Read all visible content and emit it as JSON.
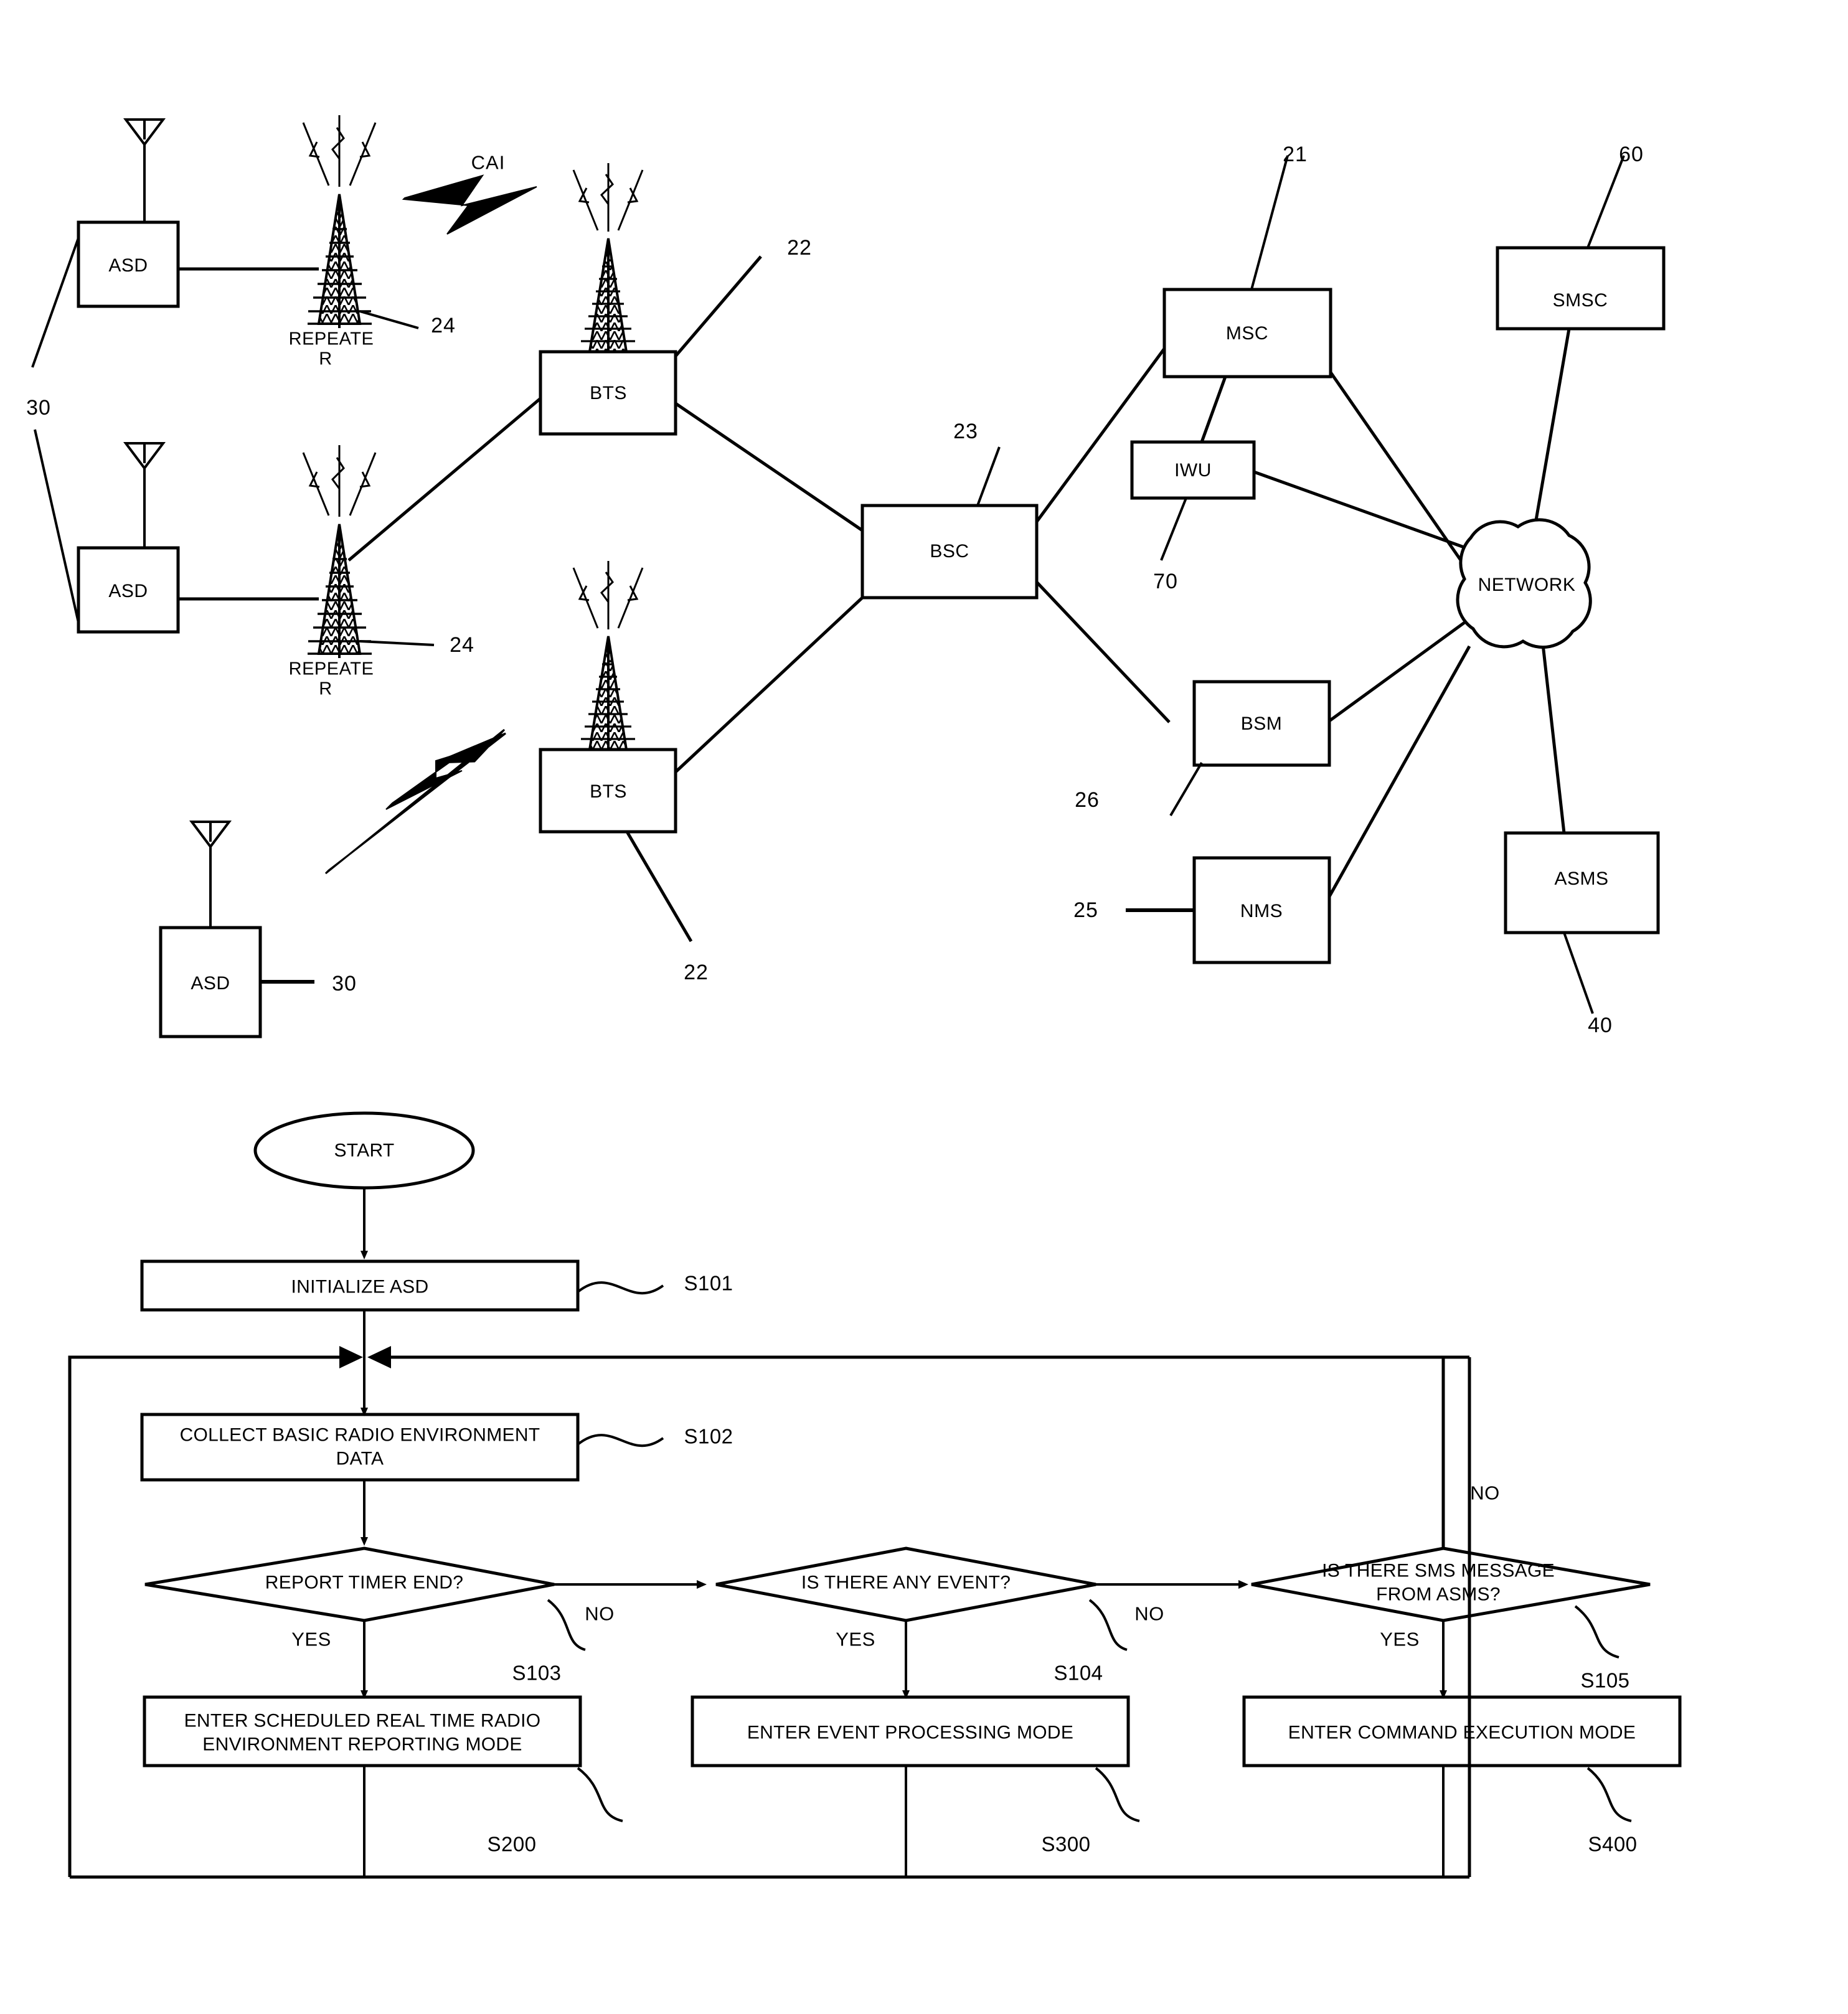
{
  "figure": {
    "title": "Wireless network architecture with ASD repeaters and ASD operating mode flowchart"
  },
  "network_diagram": {
    "nodes": [
      {
        "id": "asd1",
        "label": "ASD"
      },
      {
        "id": "asd2",
        "label": "ASD"
      },
      {
        "id": "asd3",
        "label": "ASD"
      },
      {
        "id": "bts1",
        "label": "BTS"
      },
      {
        "id": "bts2",
        "label": "BTS"
      },
      {
        "id": "bsc",
        "label": "BSC"
      },
      {
        "id": "msc",
        "label": "MSC"
      },
      {
        "id": "iwu",
        "label": "IWU"
      },
      {
        "id": "bsm",
        "label": "BSM"
      },
      {
        "id": "nms",
        "label": "NMS"
      },
      {
        "id": "smsc",
        "label": "SMSC"
      },
      {
        "id": "asms",
        "label": "ASMS"
      },
      {
        "id": "cloud",
        "label": "NETWORK"
      }
    ],
    "repeater_label_line1": "REPEATE",
    "repeater_label_line2": "R",
    "interface_label": "CAI",
    "reference_numerals": {
      "asd_group": "30",
      "asd_single": "30",
      "repeater_top": "24",
      "repeater_bottom": "24",
      "bts_top": "22",
      "bts_bottom": "22",
      "bsc": "23",
      "msc": "21",
      "iwu": "70",
      "bsm": "26",
      "nms": "25",
      "smsc": "60",
      "asms": "40"
    }
  },
  "flowchart": {
    "start_label": "START",
    "steps": [
      {
        "id": "S101",
        "label": "INITIALIZE ASD",
        "ref": "S101"
      },
      {
        "id": "S102",
        "label": "COLLECT BASIC RADIO ENVIRONMENT\nDATA",
        "ref": "S102"
      },
      {
        "id": "S200",
        "label": "ENTER SCHEDULED REAL TIME RADIO\nENVIRONMENT REPORTING MODE",
        "ref": "S200"
      },
      {
        "id": "S300",
        "label": "ENTER EVENT PROCESSING MODE",
        "ref": "S300"
      },
      {
        "id": "S400",
        "label": "ENTER COMMAND EXECUTION MODE",
        "ref": "S400"
      }
    ],
    "decisions": [
      {
        "id": "S103",
        "label": "REPORT TIMER END?",
        "ref": "S103",
        "yes": "YES",
        "no": "NO"
      },
      {
        "id": "S104",
        "label": "IS THERE ANY EVENT?",
        "ref": "S104",
        "yes": "YES",
        "no": "NO"
      },
      {
        "id": "S105",
        "label": "IS THERE SMS MESSAGE\nFROM ASMS?",
        "ref": "S105",
        "yes": "YES",
        "no": "NO"
      }
    ]
  },
  "colors": {
    "stroke": "#000000",
    "background": "#ffffff"
  }
}
